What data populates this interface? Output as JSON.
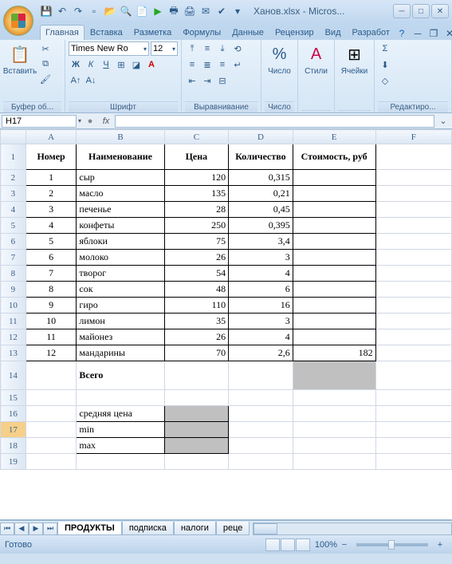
{
  "title": "Ханов.xlsx - Micros...",
  "tabs": {
    "home": "Главная",
    "insert": "Вставка",
    "layout": "Разметка",
    "formulas": "Формулы",
    "data": "Данные",
    "review": "Рецензир",
    "view": "Вид",
    "dev": "Разработ"
  },
  "ribbon": {
    "clipboard_label": "Буфер об...",
    "paste": "Вставить",
    "font_label": "Шрифт",
    "font_name": "Times New Ro",
    "font_size": "12",
    "align_label": "Выравнивание",
    "number_label": "Число",
    "number_btn": "Число",
    "styles_label": "",
    "styles_btn": "Стили",
    "cells_label": "",
    "cells_btn": "Ячейки",
    "editing_label": "Редактиро..."
  },
  "formula_bar": {
    "cell_ref": "H17",
    "fx": "fx"
  },
  "columns": [
    "A",
    "B",
    "C",
    "D",
    "E",
    "F"
  ],
  "headers": {
    "A": "Номер",
    "B": "Наименование",
    "C": "Цена",
    "D": "Количество",
    "E": "Стоимость, руб"
  },
  "rows": [
    {
      "n": "1",
      "name": "сыр",
      "price": "120",
      "qty": "0,315",
      "cost": ""
    },
    {
      "n": "2",
      "name": "масло",
      "price": "135",
      "qty": "0,21",
      "cost": ""
    },
    {
      "n": "3",
      "name": "печенье",
      "price": "28",
      "qty": "0,45",
      "cost": ""
    },
    {
      "n": "4",
      "name": "конфеты",
      "price": "250",
      "qty": "0,395",
      "cost": ""
    },
    {
      "n": "5",
      "name": "яблоки",
      "price": "75",
      "qty": "3,4",
      "cost": ""
    },
    {
      "n": "6",
      "name": "молоко",
      "price": "26",
      "qty": "3",
      "cost": ""
    },
    {
      "n": "7",
      "name": "творог",
      "price": "54",
      "qty": "4",
      "cost": ""
    },
    {
      "n": "8",
      "name": "сок",
      "price": "48",
      "qty": "6",
      "cost": ""
    },
    {
      "n": "9",
      "name": "гиро",
      "price": "110",
      "qty": "16",
      "cost": ""
    },
    {
      "n": "10",
      "name": "лимон",
      "price": "35",
      "qty": "3",
      "cost": ""
    },
    {
      "n": "11",
      "name": "майонез",
      "price": "26",
      "qty": "4",
      "cost": ""
    },
    {
      "n": "12",
      "name": "мандарины",
      "price": "70",
      "qty": "2,6",
      "cost": "182"
    }
  ],
  "total_label": "Всего",
  "stats": {
    "avg": "средняя цена",
    "min": "min",
    "max": "max"
  },
  "sheets": {
    "s1": "ПРОДУКТЫ",
    "s2": "подписка",
    "s3": "налоги",
    "s4": "реце"
  },
  "status": {
    "ready": "Готово",
    "zoom": "100%"
  }
}
